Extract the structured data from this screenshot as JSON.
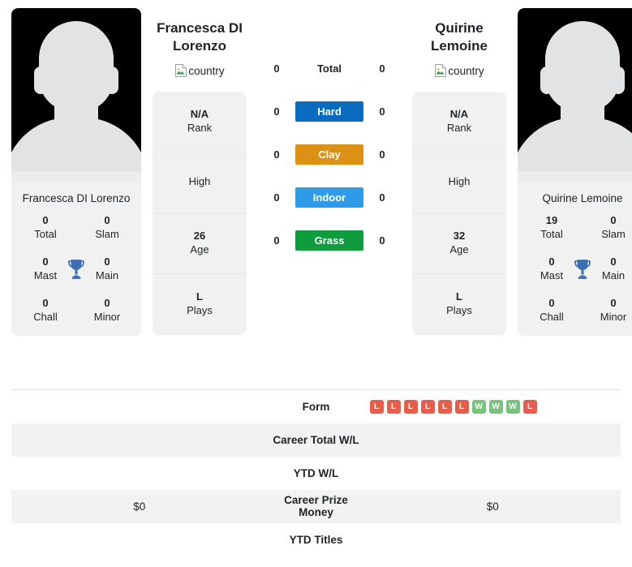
{
  "colors": {
    "hard": "#0a6cbf",
    "clay": "#dd9114",
    "indoor": "#2e9ae8",
    "grass": "#0e9c3f",
    "win": "#79c47c",
    "loss": "#ea5c4a",
    "trophy": "#3b6eb4",
    "card_bg": "#f1f1f2"
  },
  "player_left": {
    "name": "Francesca DI Lorenzo",
    "caption_name": "Francesca DI Lorenzo",
    "country_alt": "country",
    "quick_stats": [
      {
        "value": "0",
        "label": "Total"
      },
      {
        "value": "0",
        "label": "Slam"
      },
      {
        "value": "0",
        "label": "Mast"
      },
      {
        "value": "0",
        "label": "Main"
      },
      {
        "value": "0",
        "label": "Chall"
      },
      {
        "value": "0",
        "label": "Minor"
      }
    ],
    "info": [
      {
        "value": "N/A",
        "label": "Rank"
      },
      {
        "value": "",
        "label": "High"
      },
      {
        "value": "26",
        "label": "Age"
      },
      {
        "value": "L",
        "label": "Plays"
      }
    ]
  },
  "player_right": {
    "name": "Quirine Lemoine",
    "caption_name": "Quirine Lemoine",
    "country_alt": "country",
    "quick_stats": [
      {
        "value": "19",
        "label": "Total"
      },
      {
        "value": "0",
        "label": "Slam"
      },
      {
        "value": "0",
        "label": "Mast"
      },
      {
        "value": "0",
        "label": "Main"
      },
      {
        "value": "0",
        "label": "Chall"
      },
      {
        "value": "0",
        "label": "Minor"
      }
    ],
    "info": [
      {
        "value": "N/A",
        "label": "Rank"
      },
      {
        "value": "",
        "label": "High"
      },
      {
        "value": "32",
        "label": "Age"
      },
      {
        "value": "L",
        "label": "Plays"
      }
    ]
  },
  "surfaces": [
    {
      "label": "Total",
      "left": "0",
      "right": "0",
      "style": "plain",
      "color": ""
    },
    {
      "label": "Hard",
      "left": "0",
      "right": "0",
      "style": "badge",
      "color": "#0a6cbf"
    },
    {
      "label": "Clay",
      "left": "0",
      "right": "0",
      "style": "badge",
      "color": "#dd9114"
    },
    {
      "label": "Indoor",
      "left": "0",
      "right": "0",
      "style": "badge",
      "color": "#2e9ae8"
    },
    {
      "label": "Grass",
      "left": "0",
      "right": "0",
      "style": "badge",
      "color": "#0e9c3f"
    }
  ],
  "table": {
    "rows": [
      {
        "label": "Form",
        "left": "",
        "right": "",
        "left_form": [],
        "right_form": [
          "L",
          "L",
          "L",
          "L",
          "L",
          "L",
          "W",
          "W",
          "W",
          "L"
        ],
        "striped": false
      },
      {
        "label": "Career Total W/L",
        "left": "",
        "right": "",
        "left_form": [],
        "right_form": [],
        "striped": true
      },
      {
        "label": "YTD W/L",
        "left": "",
        "right": "",
        "left_form": [],
        "right_form": [],
        "striped": false
      },
      {
        "label": "Career Prize Money",
        "left": "$0",
        "right": "$0",
        "left_form": [],
        "right_form": [],
        "striped": true
      },
      {
        "label": "YTD Titles",
        "left": "",
        "right": "",
        "left_form": [],
        "right_form": [],
        "striped": false
      }
    ]
  }
}
